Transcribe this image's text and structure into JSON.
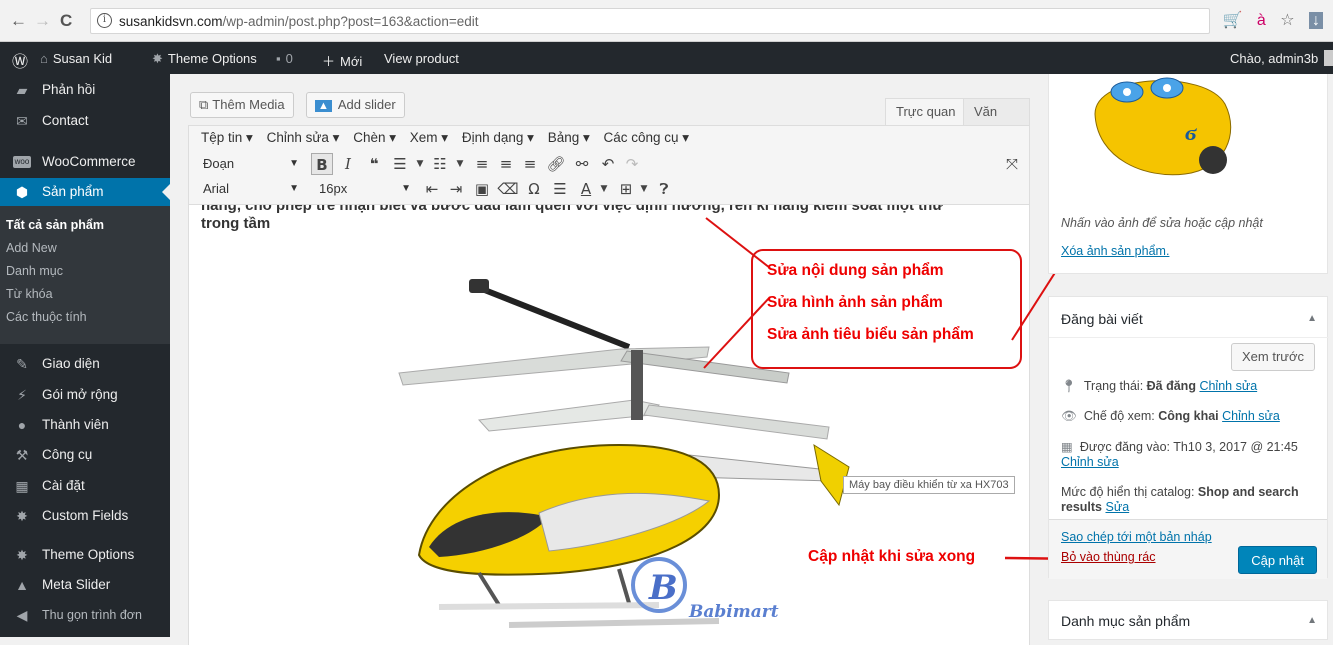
{
  "browser": {
    "back": "←",
    "forward": "→",
    "reload": "C",
    "url_domain": "susankidsvn.com",
    "url_path": "/wp-admin/post.php?post=163&action=edit"
  },
  "admin_bar": {
    "site_name": "Susan Kid",
    "theme_options": "Theme Options",
    "comments_count": "0",
    "new_label": "Mới",
    "view_product": "View product",
    "greeting": "Chào, admin3b"
  },
  "sidebar": {
    "items": [
      {
        "label": "Phản hồi",
        "icon": "comment-icon"
      },
      {
        "label": "Contact",
        "icon": "mail-icon"
      },
      {
        "label": "WooCommerce",
        "icon": "woocommerce-icon"
      },
      {
        "label": "Sản phẩm",
        "icon": "product-icon"
      },
      {
        "label": "Giao diện",
        "icon": "brush-icon"
      },
      {
        "label": "Gói mở rộng",
        "icon": "plugin-icon"
      },
      {
        "label": "Thành viên",
        "icon": "users-icon"
      },
      {
        "label": "Công cụ",
        "icon": "wrench-icon"
      },
      {
        "label": "Cài đặt",
        "icon": "settings-icon"
      },
      {
        "label": "Custom Fields",
        "icon": "gear-icon"
      },
      {
        "label": "Theme Options",
        "icon": "gear-icon"
      },
      {
        "label": "Meta Slider",
        "icon": "slider-icon"
      },
      {
        "label": "Thu gọn trình đơn",
        "icon": "collapse-icon"
      }
    ],
    "submenu": [
      "Tất cả sản phẩm",
      "Add New",
      "Danh mục",
      "Từ khóa",
      "Các thuộc tính"
    ]
  },
  "editor": {
    "add_media": "Thêm Media",
    "add_slider": "Add slider",
    "tab_visual": "Trực quan",
    "tab_text": "Văn bản",
    "menubar": [
      "Tệp tin ▾",
      "Chỉnh sửa ▾",
      "Chèn ▾",
      "Xem ▾",
      "Định dạng ▾",
      "Bảng ▾",
      "Các công cụ ▾"
    ],
    "format_select": "Đoạn",
    "font_select": "Arial",
    "size_select": "16px",
    "content_line1": "năng, cho phép trẻ nhận biết và bước đầu làm quen với việc định hướng, rèn kĩ năng kiểm soát một thứ",
    "content_line2": "trong tầm",
    "image_tooltip": "Máy bay điều khiển từ xa HX703",
    "watermark": "Babimart"
  },
  "annotations": {
    "edit_content": "Sửa nội dung sản phẩm",
    "edit_images": "Sửa hình ảnh sản phẩm",
    "edit_featured": "Sửa ảnh tiêu biểu sản phẩm",
    "update_when_done": "Cập nhật khi sửa xong"
  },
  "featured_image": {
    "hint": "Nhấn vào ảnh để sửa hoặc cập nhật",
    "remove": "Xóa ảnh sản phẩm."
  },
  "publish": {
    "title": "Đăng bài viết",
    "preview": "Xem trước",
    "status_label": "Trạng thái: ",
    "status_value": "Đã đăng",
    "visibility_label": "Chế độ xem: ",
    "visibility_value": "Công khai",
    "published_label": "Được đăng vào: ",
    "published_value": "Th10 3, 2017 @ 21:45",
    "edit_link": "Chỉnh sửa",
    "catalog_label": "Mức độ hiển thị catalog: ",
    "catalog_value": "Shop and search results",
    "catalog_edit": "Sửa",
    "copy_draft": "Sao chép tới một bản nháp",
    "trash": "Bỏ vào thùng rác",
    "update": "Cập nhật"
  },
  "categories_box": {
    "title": "Danh mục sản phẩm"
  },
  "colors": {
    "admin_dark": "#23282d",
    "wp_blue": "#0073aa",
    "annotation_red": "#e00000",
    "helicopter_yellow": "#f5d000"
  }
}
